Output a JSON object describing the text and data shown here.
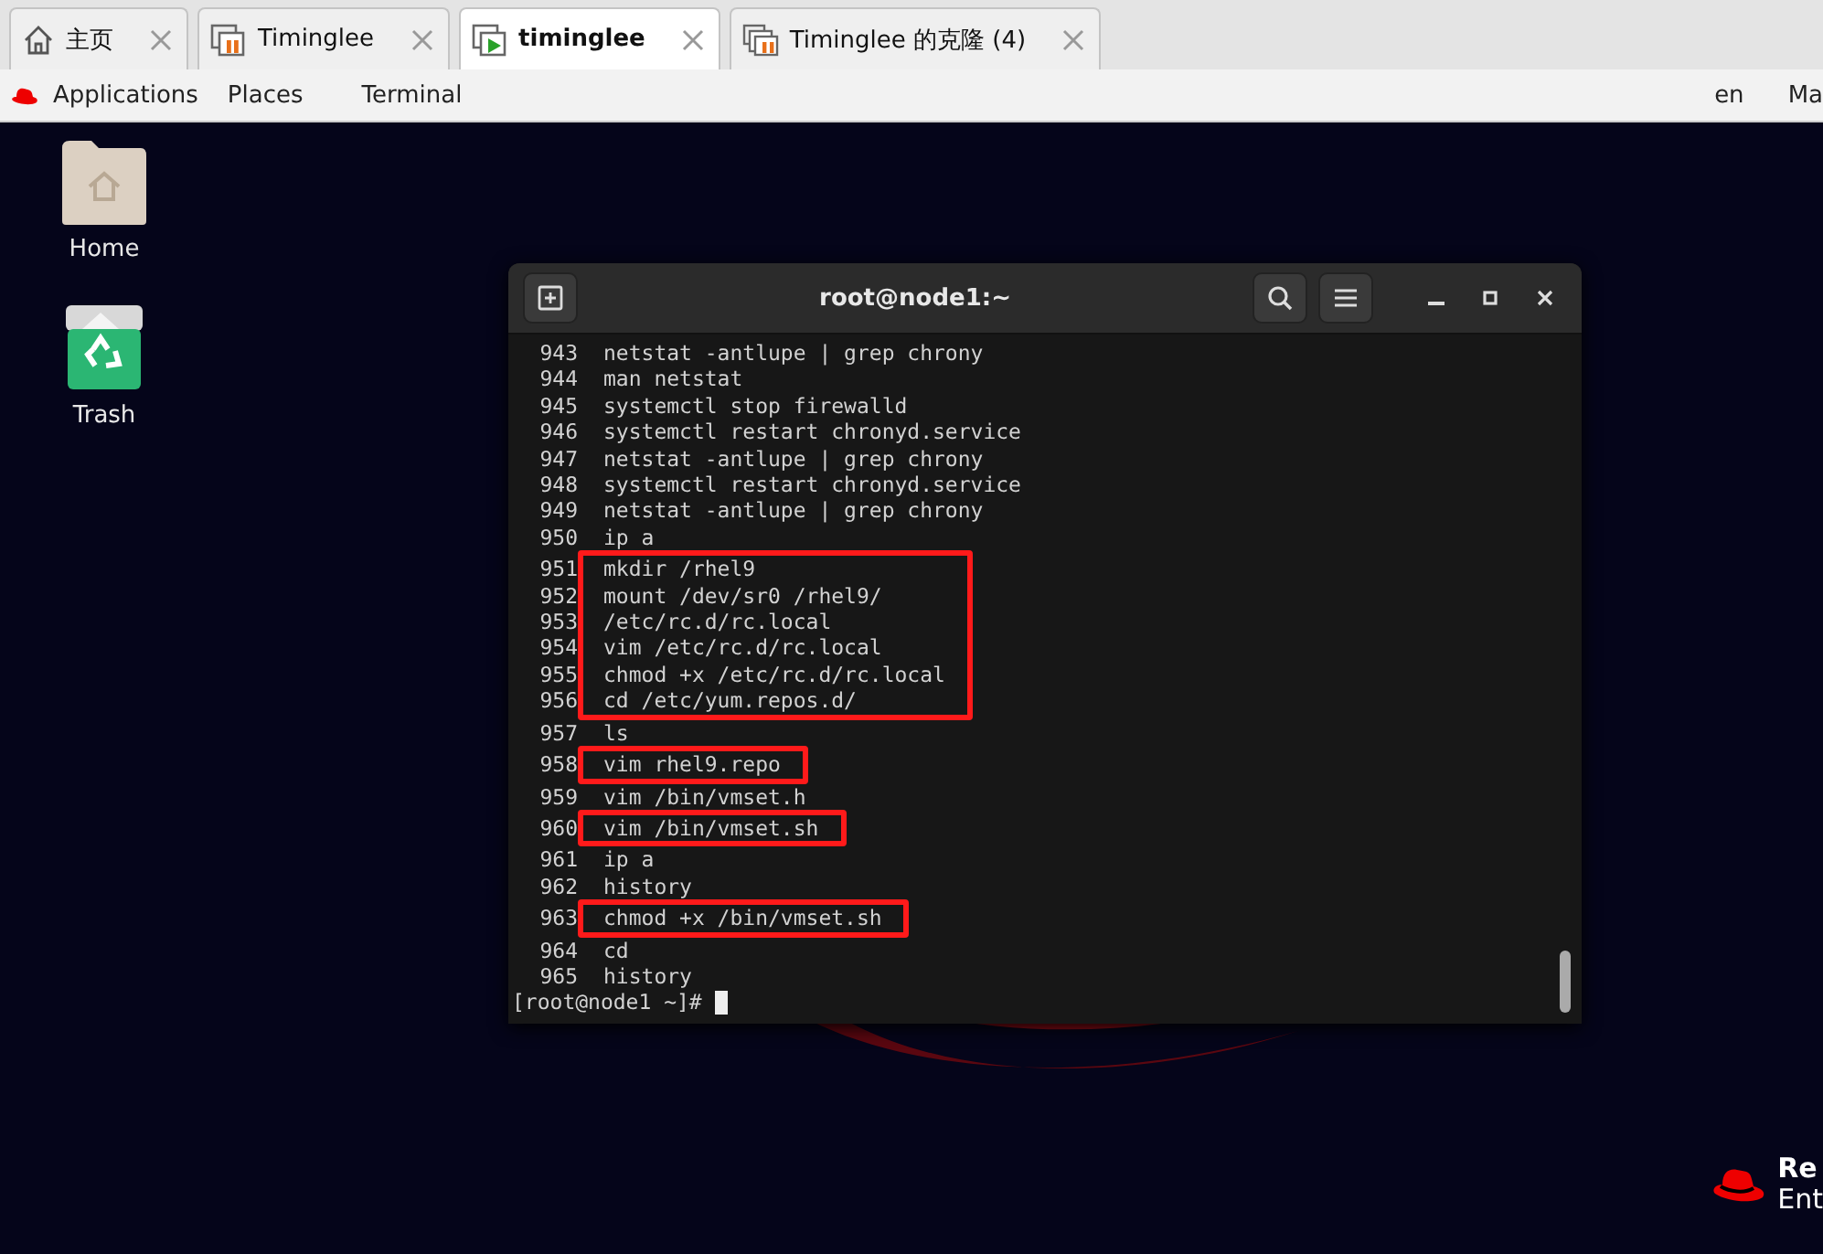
{
  "browser_tabs": [
    {
      "label": "主页",
      "selected": false
    },
    {
      "label": "Timinglee",
      "selected": false
    },
    {
      "label": "timinglee",
      "selected": true
    },
    {
      "label": "Timinglee 的克隆 (4)",
      "selected": false
    }
  ],
  "top_bar": {
    "menus": [
      "Applications",
      "Places",
      "Terminal"
    ],
    "keyboard": "en",
    "clock": "Ma"
  },
  "desktop_icons": [
    {
      "label": "Home",
      "kind": "folder"
    },
    {
      "label": "Trash",
      "kind": "trash"
    }
  ],
  "terminal": {
    "title": "root@node1:~",
    "lines": [
      {
        "number": "943",
        "command": "netstat -antlupe | grep chrony",
        "highlighted": false
      },
      {
        "number": "944",
        "command": "man netstat",
        "highlighted": false
      },
      {
        "number": "945",
        "command": "systemctl stop firewalld",
        "highlighted": false
      },
      {
        "number": "946",
        "command": "systemctl restart chronyd.service",
        "highlighted": false
      },
      {
        "number": "947",
        "command": "netstat -antlupe | grep chrony",
        "highlighted": false
      },
      {
        "number": "948",
        "command": "systemctl restart chronyd.service",
        "highlighted": false
      },
      {
        "number": "949",
        "command": "netstat -antlupe | grep chrony",
        "highlighted": false
      },
      {
        "number": "950",
        "command": "ip a",
        "highlighted": false
      },
      {
        "number": "951",
        "command": "mkdir /rhel9",
        "highlighted": true
      },
      {
        "number": "952",
        "command": "mount /dev/sr0 /rhel9/",
        "highlighted": true
      },
      {
        "number": "953",
        "command": "/etc/rc.d/rc.local",
        "highlighted": true
      },
      {
        "number": "954",
        "command": "vim /etc/rc.d/rc.local",
        "highlighted": true
      },
      {
        "number": "955",
        "command": "chmod +x /etc/rc.d/rc.local",
        "highlighted": true
      },
      {
        "number": "956",
        "command": "cd /etc/yum.repos.d/",
        "highlighted": true
      },
      {
        "number": "957",
        "command": "ls",
        "highlighted": false
      },
      {
        "number": "958",
        "command": "vim rhel9.repo",
        "highlighted": true
      },
      {
        "number": "959",
        "command": "vim /bin/vmset.h",
        "highlighted": false
      },
      {
        "number": "960",
        "command": "vim /bin/vmset.sh",
        "highlighted": true
      },
      {
        "number": "961",
        "command": "ip a",
        "highlighted": false
      },
      {
        "number": "962",
        "command": "history",
        "highlighted": false
      },
      {
        "number": "963",
        "command": "chmod +x /bin/vmset.sh",
        "highlighted": true
      },
      {
        "number": "964",
        "command": "cd",
        "highlighted": false
      },
      {
        "number": "965",
        "command": "history",
        "highlighted": false
      }
    ],
    "prompt": "[root@node1 ~]#"
  },
  "brand": {
    "lines": [
      "Re",
      "Ent"
    ]
  }
}
